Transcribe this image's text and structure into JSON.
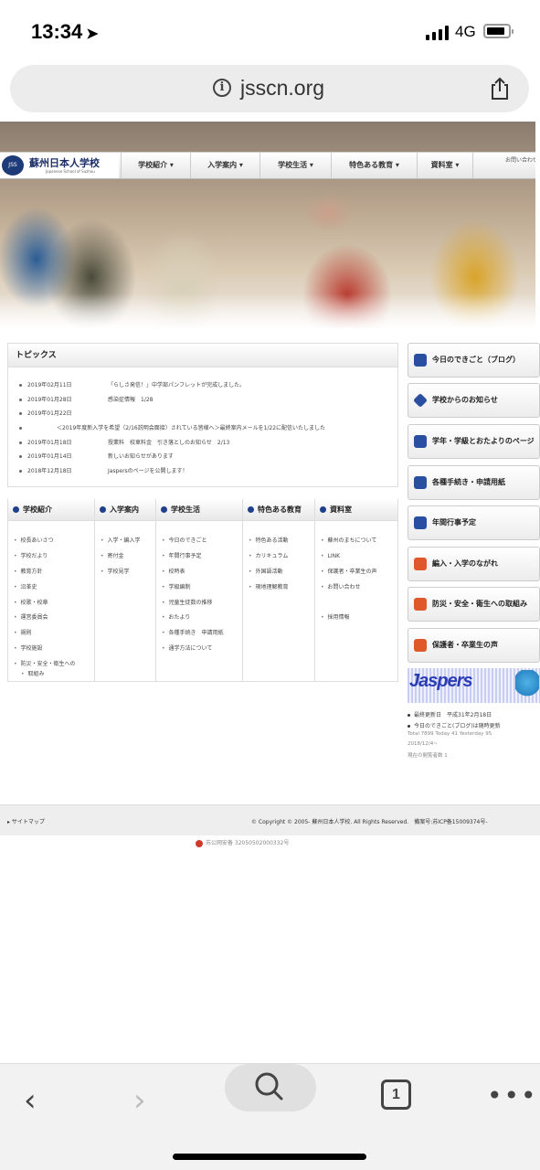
{
  "status": {
    "time": "13:34",
    "network": "4G"
  },
  "browser": {
    "url": "jsscn.org",
    "tab_count": "1"
  },
  "site": {
    "logo_jp": "蘇州日本人学校",
    "logo_en": "Japanese School of Suzhou",
    "logo_emblem": "JSS",
    "nav": [
      "学校紹介 ▾",
      "入学案内 ▾",
      "学校生活 ▾",
      "特色ある教育 ▾",
      "資料室 ▾"
    ],
    "nav_contact": "お問い合わせ",
    "topics_title": "トピックス",
    "topics": [
      {
        "date": "2019年02月11日",
        "text": "「らしさ発信！」中学部パンフレットが完成しました。"
      },
      {
        "date": "2019年01月28日",
        "text": "感染症情報　1/28"
      },
      {
        "date": "2019年01月22日",
        "text": ""
      },
      {
        "date": "",
        "text": "＜2019年度新入学を希望（2/16説明会面接）されている皆様へ＞最終案内メールを1/22に配信いたしました"
      },
      {
        "date": "2019年01月18日",
        "text": "授業料　校車料金　引き落としのお知らせ　2/13"
      },
      {
        "date": "2019年01月14日",
        "text": "新しいお知らせがあります"
      },
      {
        "date": "2018年12月18日",
        "text": "Jaspersのページを公開します！"
      }
    ],
    "menu": [
      {
        "title": "学校紹介",
        "items": [
          "校長あいさつ",
          "学校だより",
          "教育方針",
          "沿革史",
          "校歌・校章",
          "運営委員会",
          "規則",
          "学校施設",
          "防災・安全・衛生への",
          "取組み"
        ]
      },
      {
        "title": "入学案内",
        "items": [
          "入学・編入学",
          "寄付金",
          "学校見学"
        ]
      },
      {
        "title": "学校生活",
        "items": [
          "今日のできごと",
          "年間行事予定",
          "校時表",
          "学級編制",
          "児童生徒数の推移",
          "おたより",
          "各種手続き　申請用紙",
          "通学方法について"
        ]
      },
      {
        "title": "特色ある教育",
        "items": [
          "特色ある活動",
          "カリキュラム",
          "外国語活動",
          "現地理解教育"
        ]
      },
      {
        "title": "資料室",
        "items": [
          "蘇州のまちについて",
          "LINK",
          "保護者・卒業生の声",
          "お問い合わせ",
          "",
          "採用情報"
        ]
      }
    ],
    "side_buttons": [
      {
        "label": "今日のできごと（ブログ）",
        "icon": "speech-bubble-icon",
        "color": "#2a4fa0"
      },
      {
        "label": "学校からのお知らせ",
        "icon": "tag-icon",
        "color": "#2a4fa0"
      },
      {
        "label": "学年・学級とおたよりのページ",
        "icon": "pencil-icon",
        "color": "#2a4fa0"
      },
      {
        "label": "各種手続き・申請用紙",
        "icon": "pencil-icon",
        "color": "#2a4fa0"
      },
      {
        "label": "年間行事予定",
        "icon": "calendar-icon",
        "color": "#2a4fa0"
      },
      {
        "label": "編入・入学のながれ",
        "icon": "pencil-icon",
        "color": "#e0572a"
      },
      {
        "label": "防災・安全・衛生への取組み",
        "icon": "clipboard-icon",
        "color": "#e0572a"
      },
      {
        "label": "保護者・卒業生の声",
        "icon": "pencil-icon",
        "color": "#e0572a"
      }
    ],
    "jaspers": "Jaspers",
    "updates": [
      "最終更新日　平成31年2月18日",
      "今日のできごと(ブログ)は随時更新"
    ],
    "counter": [
      "Total 7899 Today 41 Yesterday 95",
      "2018/12/4~",
      "現在の閲覧者数 1"
    ],
    "footer_sitemap": "サイトマップ",
    "footer_copyright": "© Copyright © 2005- 蘇州日本人学校. All Rights Reserved.　備案号:苏ICP备15009374号-",
    "icp": "苏公网安备 32050502000332号"
  }
}
